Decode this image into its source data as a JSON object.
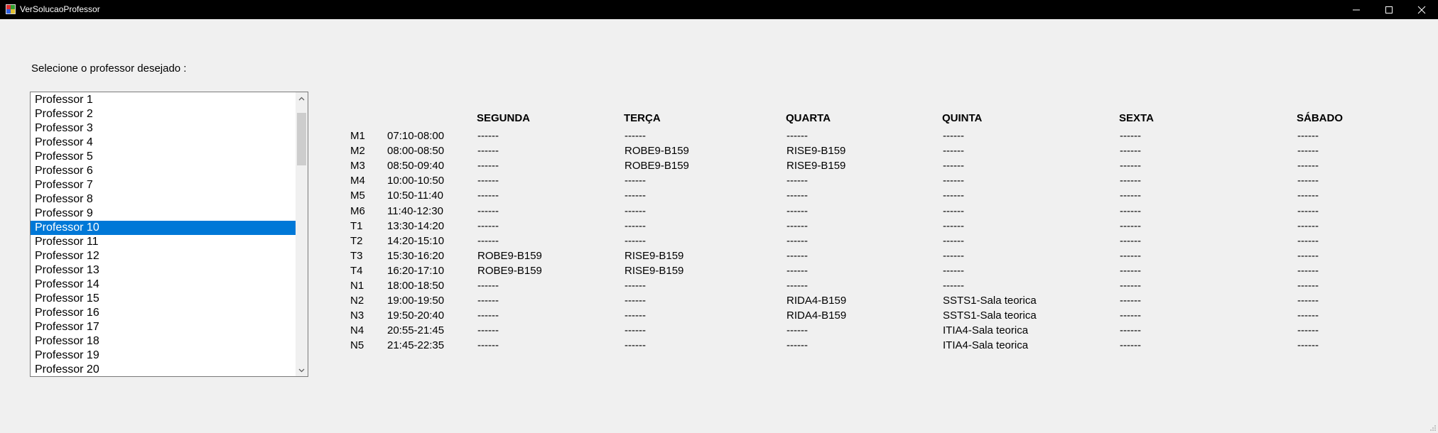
{
  "window": {
    "title": "VerSolucaoProfessor",
    "controls": [
      "minimize-icon",
      "maximize-icon",
      "close-icon"
    ]
  },
  "prompt_label": "Selecione o professor desejado :",
  "professor_list": {
    "items": [
      "Professor 1",
      "Professor 2",
      "Professor 3",
      "Professor 4",
      "Professor 5",
      "Professor 6",
      "Professor 7",
      "Professor 8",
      "Professor 9",
      "Professor 10",
      "Professor 11",
      "Professor 12",
      "Professor 13",
      "Professor 14",
      "Professor 15",
      "Professor 16",
      "Professor 17",
      "Professor 18",
      "Professor 19",
      "Professor 20"
    ],
    "selected": "Professor 10",
    "selected_index": 9
  },
  "schedule": {
    "days": [
      "SEGUNDA",
      "TERÇA",
      "QUARTA",
      "QUINTA",
      "SEXTA",
      "SÁBADO"
    ],
    "rows": [
      {
        "period": "M1",
        "time": "07:10-08:00",
        "cells": [
          "------",
          "------",
          "------",
          "------",
          "------",
          "------"
        ]
      },
      {
        "period": "M2",
        "time": "08:00-08:50",
        "cells": [
          "------",
          "ROBE9-B159",
          "RISE9-B159",
          "------",
          "------",
          "------"
        ]
      },
      {
        "period": "M3",
        "time": "08:50-09:40",
        "cells": [
          "------",
          "ROBE9-B159",
          "RISE9-B159",
          "------",
          "------",
          "------"
        ]
      },
      {
        "period": "M4",
        "time": "10:00-10:50",
        "cells": [
          "------",
          "------",
          "------",
          "------",
          "------",
          "------"
        ]
      },
      {
        "period": "M5",
        "time": "10:50-11:40",
        "cells": [
          "------",
          "------",
          "------",
          "------",
          "------",
          "------"
        ]
      },
      {
        "period": "M6",
        "time": "11:40-12:30",
        "cells": [
          "------",
          "------",
          "------",
          "------",
          "------",
          "------"
        ]
      },
      {
        "period": "T1",
        "time": "13:30-14:20",
        "cells": [
          "------",
          "------",
          "------",
          "------",
          "------",
          "------"
        ]
      },
      {
        "period": "T2",
        "time": "14:20-15:10",
        "cells": [
          "------",
          "------",
          "------",
          "------",
          "------",
          "------"
        ]
      },
      {
        "period": "T3",
        "time": "15:30-16:20",
        "cells": [
          "ROBE9-B159",
          "RISE9-B159",
          "------",
          "------",
          "------",
          "------"
        ]
      },
      {
        "period": "T4",
        "time": "16:20-17:10",
        "cells": [
          "ROBE9-B159",
          "RISE9-B159",
          "------",
          "------",
          "------",
          "------"
        ]
      },
      {
        "period": "N1",
        "time": "18:00-18:50",
        "cells": [
          "------",
          "------",
          "------",
          "------",
          "------",
          "------"
        ]
      },
      {
        "period": "N2",
        "time": "19:00-19:50",
        "cells": [
          "------",
          "------",
          "RIDA4-B159",
          "SSTS1-Sala teorica",
          "------",
          "------"
        ]
      },
      {
        "period": "N3",
        "time": "19:50-20:40",
        "cells": [
          "------",
          "------",
          "RIDA4-B159",
          "SSTS1-Sala teorica",
          "------",
          "------"
        ]
      },
      {
        "period": "N4",
        "time": "20:55-21:45",
        "cells": [
          "------",
          "------",
          "------",
          "ITIA4-Sala teorica",
          "------",
          "------"
        ]
      },
      {
        "period": "N5",
        "time": "21:45-22:35",
        "cells": [
          "------",
          "------",
          "------",
          "ITIA4-Sala teorica",
          "------",
          "------"
        ]
      }
    ]
  }
}
